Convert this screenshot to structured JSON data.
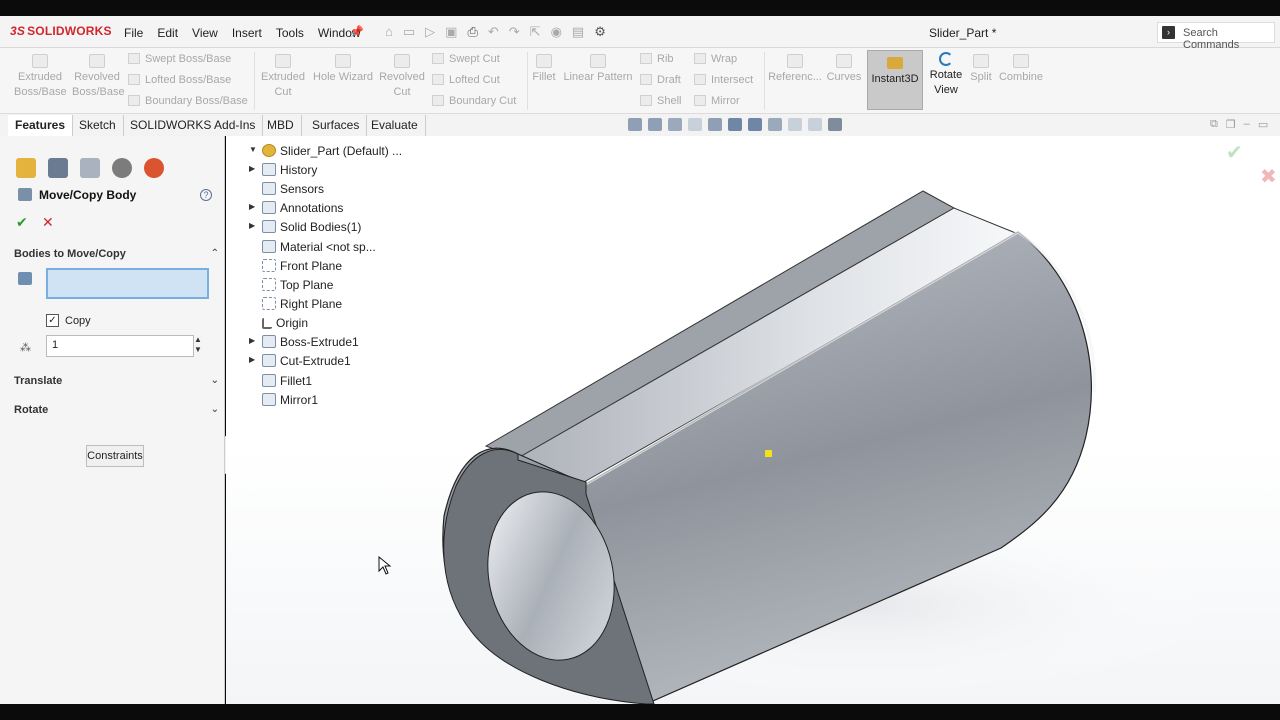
{
  "app": {
    "logo_text": "SOLIDWORKS",
    "logo_prefix": "3S",
    "document_title": "Slider_Part *"
  },
  "menu": [
    "File",
    "Edit",
    "View",
    "Insert",
    "Tools",
    "Window"
  ],
  "search": {
    "placeholder": "Search Commands"
  },
  "ribbon": {
    "extruded_boss": "Extruded Boss/Base",
    "revolved_boss": "Revolved Boss/Base",
    "swept_boss": "Swept Boss/Base",
    "lofted_boss": "Lofted Boss/Base",
    "boundary_boss": "Boundary Boss/Base",
    "extruded_cut": "Extruded Cut",
    "hole_wizard": "Hole Wizard",
    "revolved_cut": "Revolved Cut",
    "swept_cut": "Swept Cut",
    "lofted_cut": "Lofted Cut",
    "boundary_cut": "Boundary Cut",
    "fillet": "Fillet",
    "linear_pattern": "Linear Pattern",
    "rib": "Rib",
    "draft": "Draft",
    "shell": "Shell",
    "wrap": "Wrap",
    "intersect": "Intersect",
    "mirror": "Mirror",
    "reference": "Referenc...",
    "curves": "Curves",
    "instant3d": "Instant3D",
    "rotate_view": "Rotate View",
    "split": "Split",
    "combine": "Combine"
  },
  "tabs": [
    "Features",
    "Sketch",
    "SOLIDWORKS Add-Ins",
    "MBD",
    "Surfaces",
    "Evaluate"
  ],
  "property_manager": {
    "title": "Move/Copy Body",
    "help": "?",
    "ok": "✔",
    "cancel": "✕",
    "bodies_section": "Bodies to Move/Copy",
    "copy_label": "Copy",
    "copy_checked": true,
    "count_value": "1",
    "translate_section": "Translate",
    "rotate_section": "Rotate",
    "constraints_button": "Constraints"
  },
  "feature_tree": {
    "root": "Slider_Part (Default) ...",
    "items": [
      "History",
      "Sensors",
      "Annotations",
      "Solid Bodies(1)",
      "Material <not sp...",
      "Front Plane",
      "Top Plane",
      "Right Plane",
      "Origin",
      "Boss-Extrude1",
      "Cut-Extrude1",
      "Fillet1",
      "Mirror1"
    ]
  },
  "colors": {
    "accent": "#d0262e",
    "selection": "#cfe3f5",
    "ok_green": "#2e9a2e",
    "cancel_red": "#d02828"
  }
}
